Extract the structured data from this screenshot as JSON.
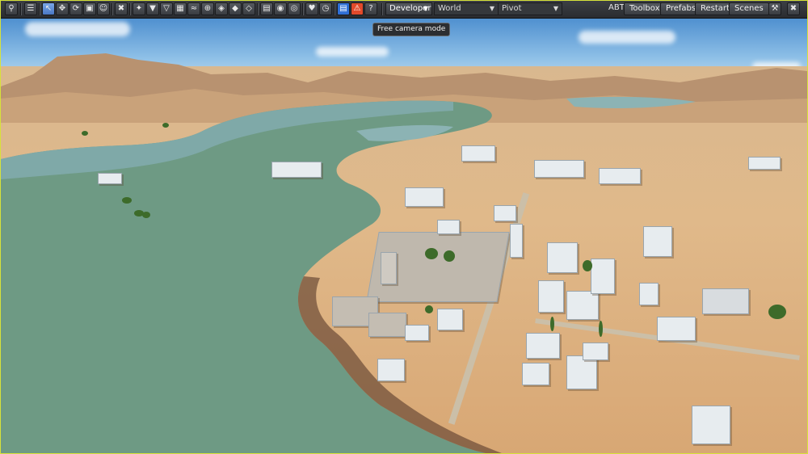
{
  "toolbar": {
    "mode_dropdown": "Developer",
    "world_dropdown": "World",
    "pivot_dropdown": "Pivot",
    "abt_label": "ABT",
    "toolbox_button": "Toolbox",
    "prefabs_button": "Prefabs",
    "restart_button": "Restart",
    "scenes_button": "Scenes"
  },
  "tooltip": {
    "text": "Free camera mode"
  },
  "colors": {
    "frame_border": "#d7e23a",
    "toolbar_bg": "#2a2c30",
    "active_tool": "#4a78c4",
    "warning_button": "#e24a2b",
    "save_button": "#2f6fd6"
  }
}
